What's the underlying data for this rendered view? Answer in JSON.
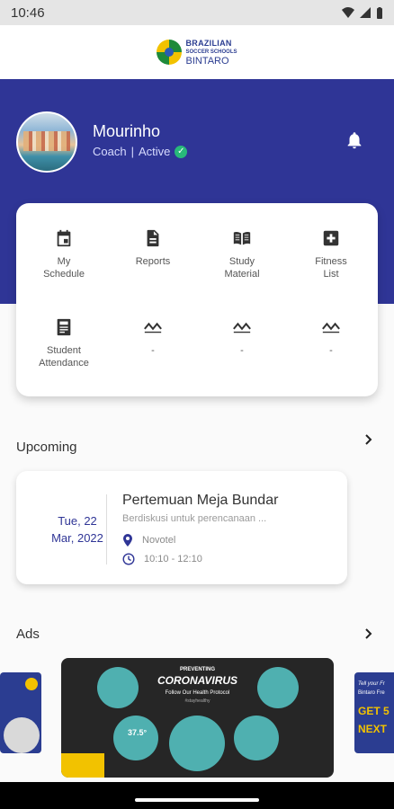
{
  "status_bar": {
    "time": "10:46"
  },
  "brand": {
    "line1": "BRAZILIAN",
    "line2": "SOCCER SCHOOLS",
    "line3": "BINTARO"
  },
  "profile": {
    "name": "Mourinho",
    "role": "Coach",
    "separator": "|",
    "status": "Active"
  },
  "menu": [
    {
      "label1": "My",
      "label2": "Schedule",
      "icon": "calendar-icon"
    },
    {
      "label1": "Reports",
      "label2": "",
      "icon": "document-icon"
    },
    {
      "label1": "Study",
      "label2": "Material",
      "icon": "book-icon"
    },
    {
      "label1": "Fitness",
      "label2": "List",
      "icon": "medical-plus-icon"
    },
    {
      "label1": "Student",
      "label2": "Attendance",
      "icon": "attendance-icon"
    },
    {
      "label1": "-",
      "label2": "",
      "icon": "pulse-icon"
    },
    {
      "label1": "-",
      "label2": "",
      "icon": "pulse-icon"
    },
    {
      "label1": "-",
      "label2": "",
      "icon": "pulse-icon"
    }
  ],
  "upcoming": {
    "title": "Upcoming",
    "event": {
      "day": "Tue, 22",
      "month_year": "Mar, 2022",
      "title": "Pertemuan Meja Bundar",
      "description": "Berdiskusi untuk perencanaan ...",
      "location": "Novotel",
      "time": "10:10 - 12:10"
    }
  },
  "ads": {
    "title": "Ads",
    "main": {
      "line1": "PREVENTING",
      "line2": "CORONAVIRUS",
      "line3": "Follow Our Health Protocol",
      "line4": "#stayhealthy",
      "temp": "37.5°"
    },
    "right": {
      "line1": "Tell your Fr",
      "line2": "Bintaro Fre",
      "line3": "GET 5",
      "line4": "NEXT"
    }
  },
  "colors": {
    "primary": "#2f3596",
    "verified": "#28b97a"
  }
}
